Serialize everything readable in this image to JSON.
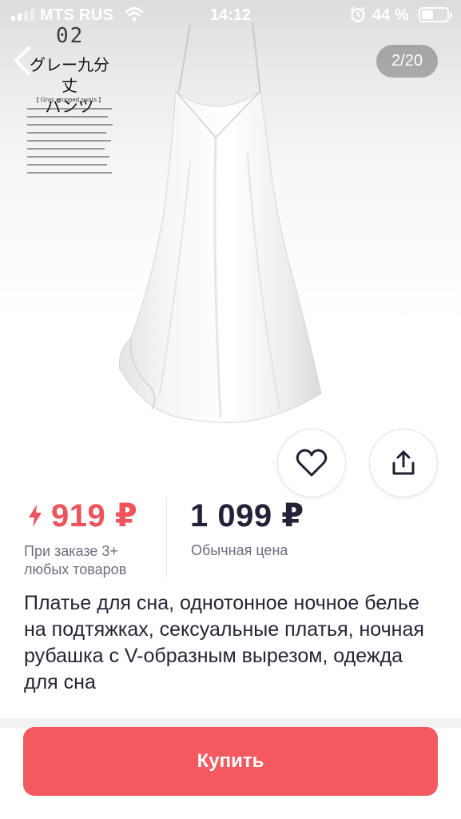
{
  "status_bar": {
    "carrier": "MTS RUS",
    "time": "14:12",
    "battery": "44 %"
  },
  "gallery": {
    "counter": "2/20",
    "image_text": {
      "number": "02",
      "title_line1": "グレー九分丈",
      "title_line2": "パンツ",
      "subtitle": "【 Gray cropped pants 】"
    }
  },
  "price": {
    "sale": "919 ₽",
    "sale_note": "При заказе 3+ любых товаров",
    "regular": "1 099 ₽",
    "regular_note": "Обычная цена"
  },
  "product": {
    "title": "Платье для сна, однотонное ночное белье на подтяжках, сексуальные платья, ночная рубашка с V-образным вырезом, одежда для сна"
  },
  "actions": {
    "buy_label": "Купить"
  },
  "colors": {
    "accent": "#f3595f",
    "sale_price": "#f0535a",
    "text": "#242636"
  }
}
